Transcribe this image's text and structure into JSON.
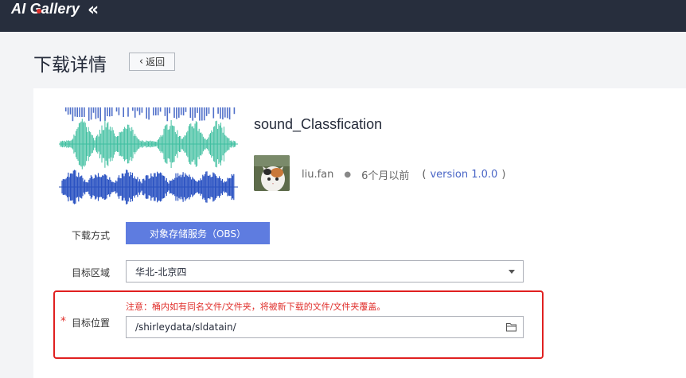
{
  "app": {
    "logo_text": "AI Gallery",
    "collapse_icon": "double-chevron-left-icon"
  },
  "header": {
    "title": "下载详情",
    "back_label": "返回"
  },
  "model": {
    "name": "sound_Classfication",
    "author": "liu.fan",
    "time": "6个月以前",
    "version": "version 1.0.0"
  },
  "form": {
    "method_label": "下载方式",
    "method_value": "对象存储服务（OBS）",
    "region_label": "目标区域",
    "region_value": "华北-北京四",
    "location_label": "目标位置",
    "warning": "注意：桶内如有同名文件/文件夹，将被新下载的文件/文件夹覆盖。",
    "path_value": "/shirleydata/sldatain/"
  },
  "colors": {
    "topbar": "#272e3d",
    "primary": "#5e7ce0",
    "warning": "#e0302c",
    "link": "#4a66c6"
  }
}
